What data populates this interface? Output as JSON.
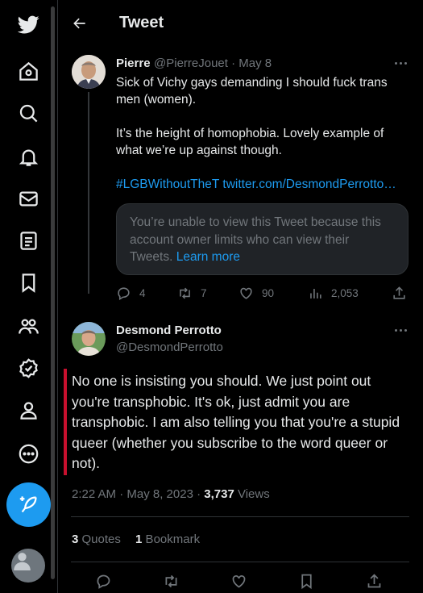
{
  "header": {
    "title": "Tweet"
  },
  "sidebar": {
    "items": [
      "home",
      "explore",
      "notifications",
      "messages",
      "lists",
      "bookmarks",
      "communities",
      "verified",
      "profile",
      "more"
    ]
  },
  "tweet_parent": {
    "name": "Pierre",
    "handle": "@PierreJouet",
    "date": "May 8",
    "meta_sep": " · ",
    "line1": "Sick of Vichy gays demanding I should fuck trans men (women).",
    "line2": "It’s the height of homophobia. Lovely example of what we’re up against though.",
    "hashtag": "#LGBWithoutTheT",
    "link": "twitter.com/DesmondPerrotto…",
    "locked_text": "You’re unable to view this Tweet because this account owner limits who can view their Tweets.",
    "locked_link": "Learn more",
    "replies": "4",
    "retweets": "7",
    "likes": "90",
    "views": "2,053"
  },
  "tweet_main": {
    "name": "Desmond Perrotto",
    "handle": "@DesmondPerrotto",
    "text": "No one is insisting you should.  We just point out you're transphobic.  It's ok, just admit you are transphobic.  I am also telling you that you're a stupid queer (whether you subscribe to the word queer or not).",
    "time": "2:22 AM · May 8, 2023 · ",
    "views_count": "3,737",
    "views_label": " Views",
    "quotes_count": "3",
    "quotes_label": " Quotes",
    "bookmarks_count": "1",
    "bookmarks_label": " Bookmark"
  },
  "colors": {
    "accent": "#1d9bf0",
    "background": "#000000",
    "highlight_bar": "#c8102e",
    "muted": "#71767b"
  }
}
